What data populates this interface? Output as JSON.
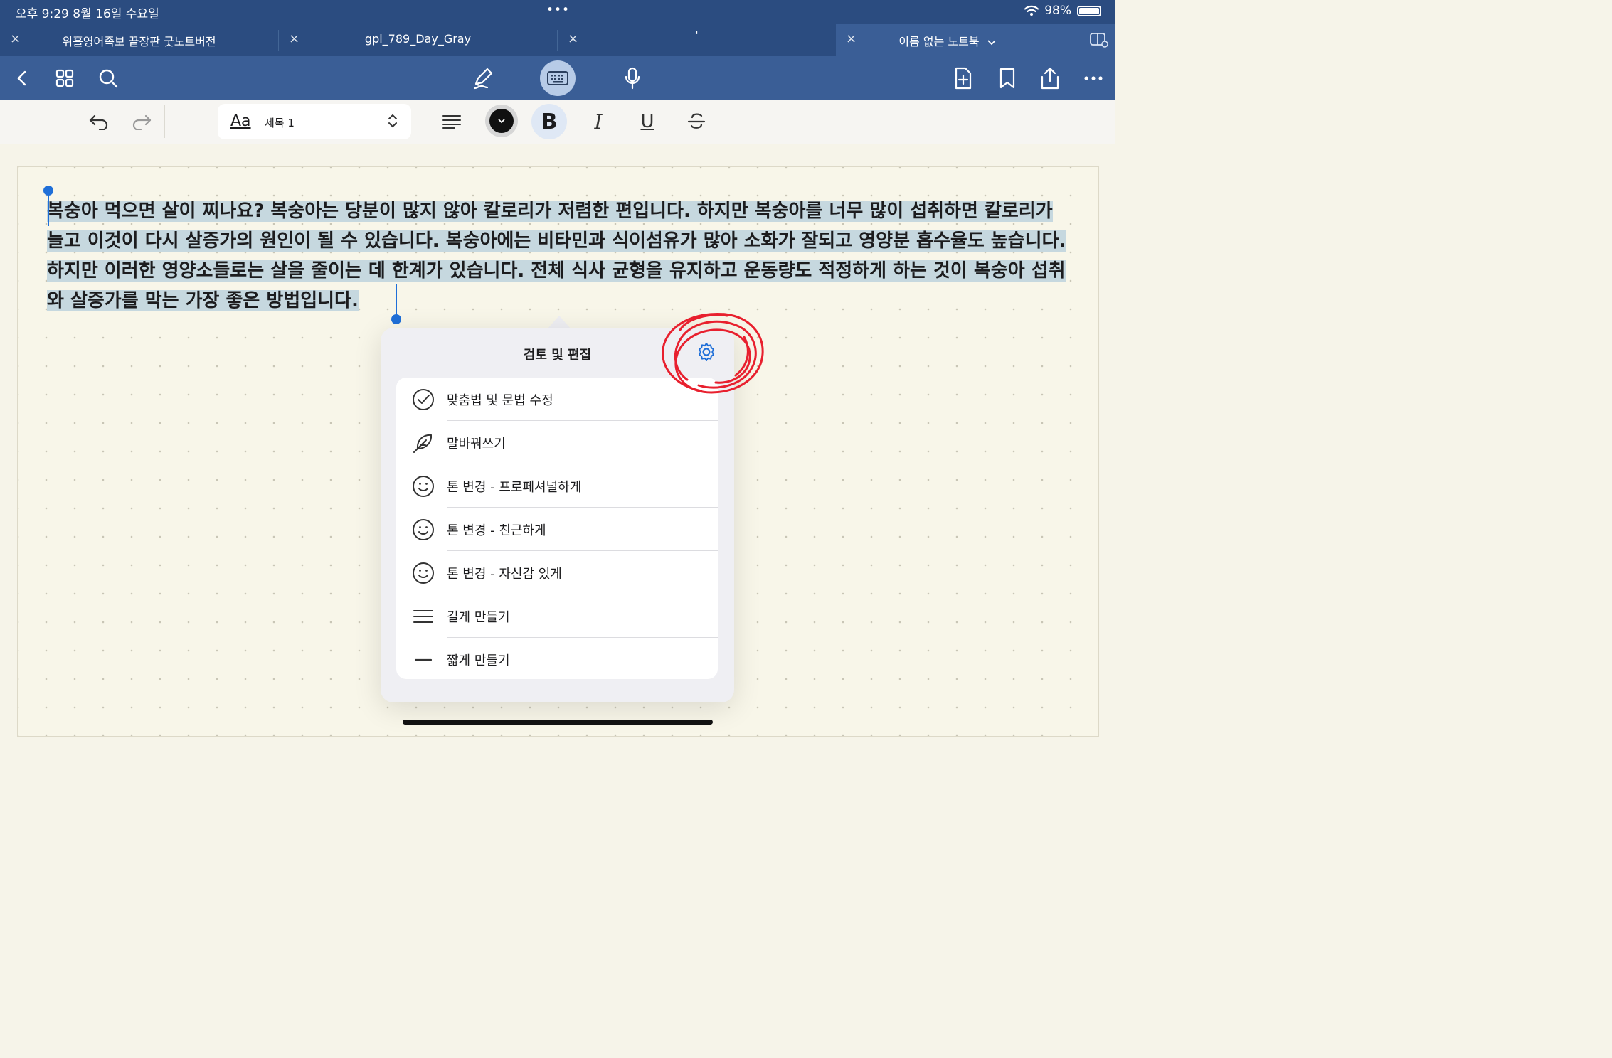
{
  "status_bar": {
    "time": "오후 9:29  8월 16일 수요일",
    "battery": "98%",
    "icons": [
      "wifi-icon",
      "battery-icon"
    ]
  },
  "tabs": [
    {
      "title": "위홀영어족보 끝장판 굿노트버전",
      "active": false
    },
    {
      "title": "gpl_789_Day_Gray",
      "active": false
    },
    {
      "title": "'",
      "active": false
    },
    {
      "title": "이름 없는 노트북",
      "active": true
    }
  ],
  "toolbar": {
    "icons": [
      "back-icon",
      "grid-icon",
      "search-icon",
      "pen-icon",
      "keyboard-icon",
      "microphone-icon",
      "add-page-icon",
      "bookmark-icon",
      "share-icon",
      "more-icon"
    ]
  },
  "format_bar": {
    "style_glyph": "Aa",
    "style_label": "제목 1",
    "bold": "B",
    "italic": "I",
    "underline": "U"
  },
  "document": {
    "text": "복숭아 먹으면 살이 찌나요? 복숭아는 당분이 많지 않아 칼로리가 저렴한 편입니다. 하지만 복숭아를 너무 많이 섭취하면 칼로리가 늘고 이것이 다시 살증가의 원인이 될 수 있습니다. 복숭아에는 비타민과 식이섬유가 많아 소화가 잘되고 영양분 흡수율도 높습니다. 하지만 이러한 영양소들로는 살을 줄이는 데 한계가 있습니다. 전체 식사 균형을 유지하고 운동량도 적정하게 하는 것이 복숭아 섭취와 살증가를 막는 가장 좋은 방법입니다."
  },
  "popup": {
    "title": "검토 및 편집",
    "items": [
      {
        "label": "맞춤법 및 문법 수정",
        "icon": "checkmark-circle-icon"
      },
      {
        "label": "말바꿔쓰기",
        "icon": "feather-icon"
      },
      {
        "label": "톤 변경 - 프로페셔널하게",
        "icon": "smiley-icon"
      },
      {
        "label": "톤 변경 - 친근하게",
        "icon": "smiley-icon"
      },
      {
        "label": "톤 변경 - 자신감 있게",
        "icon": "smiley-icon"
      },
      {
        "label": "길게 만들기",
        "icon": "lines-icon"
      },
      {
        "label": "짧게 만들기",
        "icon": "minus-icon"
      }
    ]
  },
  "colors": {
    "header": "#2b4c80",
    "toolbar": "#3a5e96",
    "selection": "#c6d8df",
    "accent": "#1f6fd8",
    "scribble": "#e8202e"
  }
}
